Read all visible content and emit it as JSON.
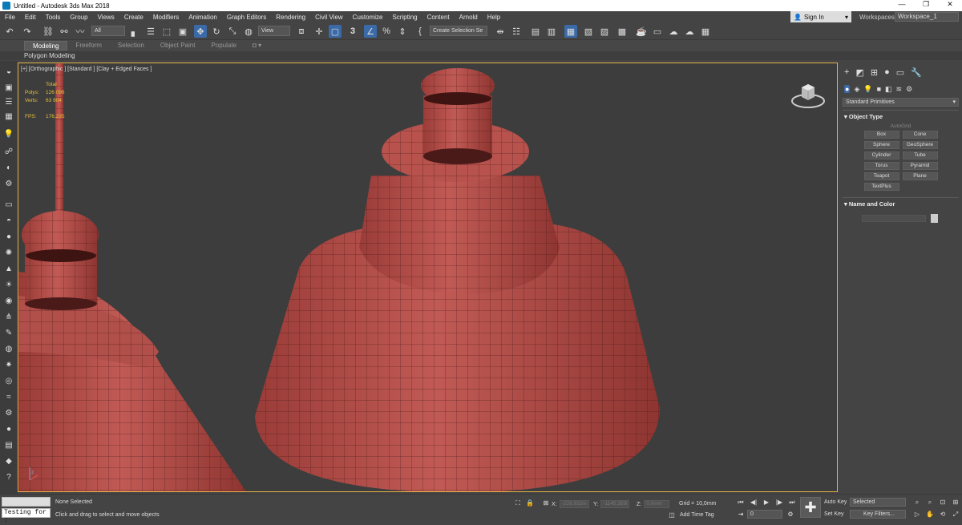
{
  "window": {
    "title": "Untitled - Autodesk 3ds Max 2018",
    "minimize": "—",
    "maximize": "❐",
    "close": "✕"
  },
  "menu": [
    "File",
    "Edit",
    "Tools",
    "Group",
    "Views",
    "Create",
    "Modifiers",
    "Animation",
    "Graph Editors",
    "Rendering",
    "Civil View",
    "Customize",
    "Scripting",
    "Content",
    "Arnold",
    "Help"
  ],
  "account": {
    "signin": "Sign In",
    "workspaces_label": "Workspaces:",
    "workspace": "Workspace_1"
  },
  "toolbar": {
    "filter": "All",
    "ref_coord": "View",
    "snap_num": "3",
    "selection_set": "Create Selection Se"
  },
  "ribbon": {
    "tabs": [
      "Modeling",
      "Freeform",
      "Selection",
      "Object Paint",
      "Populate"
    ],
    "active": "Modeling",
    "sub": "Polygon Modeling"
  },
  "viewport": {
    "label": "[+] [Orthographic ] [Standard ] [Clay + Edged Faces ]",
    "stats": {
      "header": "Total",
      "polys_k": "Polys:",
      "polys_v": "126 096",
      "verts_k": "Verts:",
      "verts_v": "63 904",
      "fps_k": "FPS:",
      "fps_v": "176,235"
    }
  },
  "command_panel": {
    "dropdown": "Standard Primitives",
    "object_type": "Object Type",
    "autogrid": "AutoGrid",
    "objects": [
      "Box",
      "Cone",
      "Sphere",
      "GeoSphere",
      "Cylinder",
      "Tube",
      "Torus",
      "Pyramid",
      "Teapot",
      "Plane",
      "TextPlus"
    ],
    "name_color": "Name and Color"
  },
  "status": {
    "maxscript": "Testing for :",
    "selected": "None Selected",
    "prompt": "Click and drag to select and move objects",
    "x": "-229,932m",
    "y": "-1145,359i",
    "z": "0,0mm",
    "grid": "Grid = 10,0mm",
    "add_time_tag": "Add Time Tag",
    "auto_key": "Auto Key",
    "set_key": "Set Key",
    "selected_dropdown": "Selected",
    "key_filters": "Key Filters...",
    "frame": "0"
  },
  "colors": {
    "accent": "#3a6aa8",
    "viewport_border": "#e2b34a",
    "model": "#b8504c",
    "stats": "#e8c33a"
  }
}
